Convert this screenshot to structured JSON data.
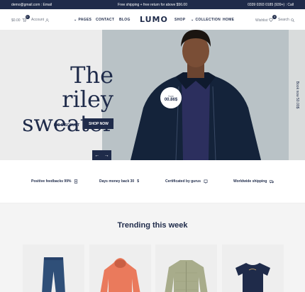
{
  "topbar": {
    "email": "demo@gmail.com : Email",
    "promo": "Free shipping + free return for above $56.00",
    "phone": "0339 0393 0185 (939+) : Call"
  },
  "header": {
    "cart_total": "$0.00",
    "cart_count": "0",
    "account_label": "Account",
    "nav_left": [
      "PAGES",
      "CONTACT",
      "BLOG"
    ],
    "logo": "LUMO",
    "nav_right": [
      "SHOP",
      "COLLECTION",
      "HOME"
    ],
    "wishlist_label": "Wishlist",
    "wishlist_count": "0",
    "search_label": "Search"
  },
  "hero": {
    "title_line1": "The riley",
    "title_line2": "sweater",
    "discount_button": "BIG DISCOUNT",
    "shop_button": "SHOP NOW",
    "price_label": "Sale",
    "price": "00.86$",
    "side_text": "Book now 50.00$",
    "prev_icon": "arrow-left-icon",
    "next_icon": "arrow-right-icon"
  },
  "features": [
    {
      "label": "Positive feedbacks 99%",
      "icon": "document-icon"
    },
    {
      "label": "Days money back 30",
      "icon": "dollar-icon"
    },
    {
      "label": "Certificated by gurus",
      "icon": "certificate-icon"
    },
    {
      "label": "Worldwide shipping",
      "icon": "truck-icon"
    }
  ],
  "trending": {
    "title": "Trending this week",
    "products": [
      {
        "name": "jeans",
        "color": "#2f4f78"
      },
      {
        "name": "hoodie",
        "color": "#ea7a5c"
      },
      {
        "name": "quilted jacket",
        "color": "#a8ac8b"
      },
      {
        "name": "t-shirt",
        "color": "#1f2b4a"
      }
    ]
  },
  "colors": {
    "brand": "#1f2b4a",
    "hero_bg": "#ececec",
    "hero_photo_bg": "#b9c2c6"
  }
}
